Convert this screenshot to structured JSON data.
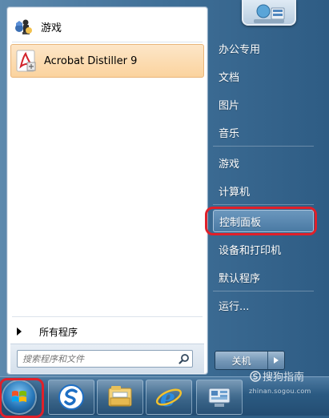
{
  "left_pane": {
    "programs": [
      {
        "label": "游戏",
        "icon": "games-icon"
      },
      {
        "label": "Acrobat Distiller 9",
        "icon": "acrobat-distiller-icon",
        "highlighted": true
      }
    ],
    "all_programs_label": "所有程序",
    "search": {
      "placeholder": "搜索程序和文件",
      "value": ""
    }
  },
  "right_pane": {
    "items": [
      {
        "label": "办公专用"
      },
      {
        "label": "文档"
      },
      {
        "label": "图片"
      },
      {
        "label": "音乐"
      },
      {
        "label": "游戏"
      },
      {
        "label": "计算机"
      },
      {
        "label": "控制面板",
        "highlighted": true
      },
      {
        "label": "设备和打印机"
      },
      {
        "label": "默认程序"
      },
      {
        "label": "运行..."
      }
    ],
    "shutdown_label": "关机"
  },
  "taskbar": {
    "buttons": [
      {
        "icon": "start-orb-icon"
      },
      {
        "icon": "sogou-browser-icon"
      },
      {
        "icon": "file-explorer-icon"
      },
      {
        "icon": "internet-explorer-icon"
      },
      {
        "icon": "control-panel-icon"
      }
    ]
  },
  "watermark": {
    "brand": "搜狗指南",
    "url": "zhinan.sogou.com"
  },
  "colors": {
    "highlight_ring": "#e0202a",
    "acrobat_highlight": "#fbd39e",
    "menu_blue": "#3f6f97"
  }
}
